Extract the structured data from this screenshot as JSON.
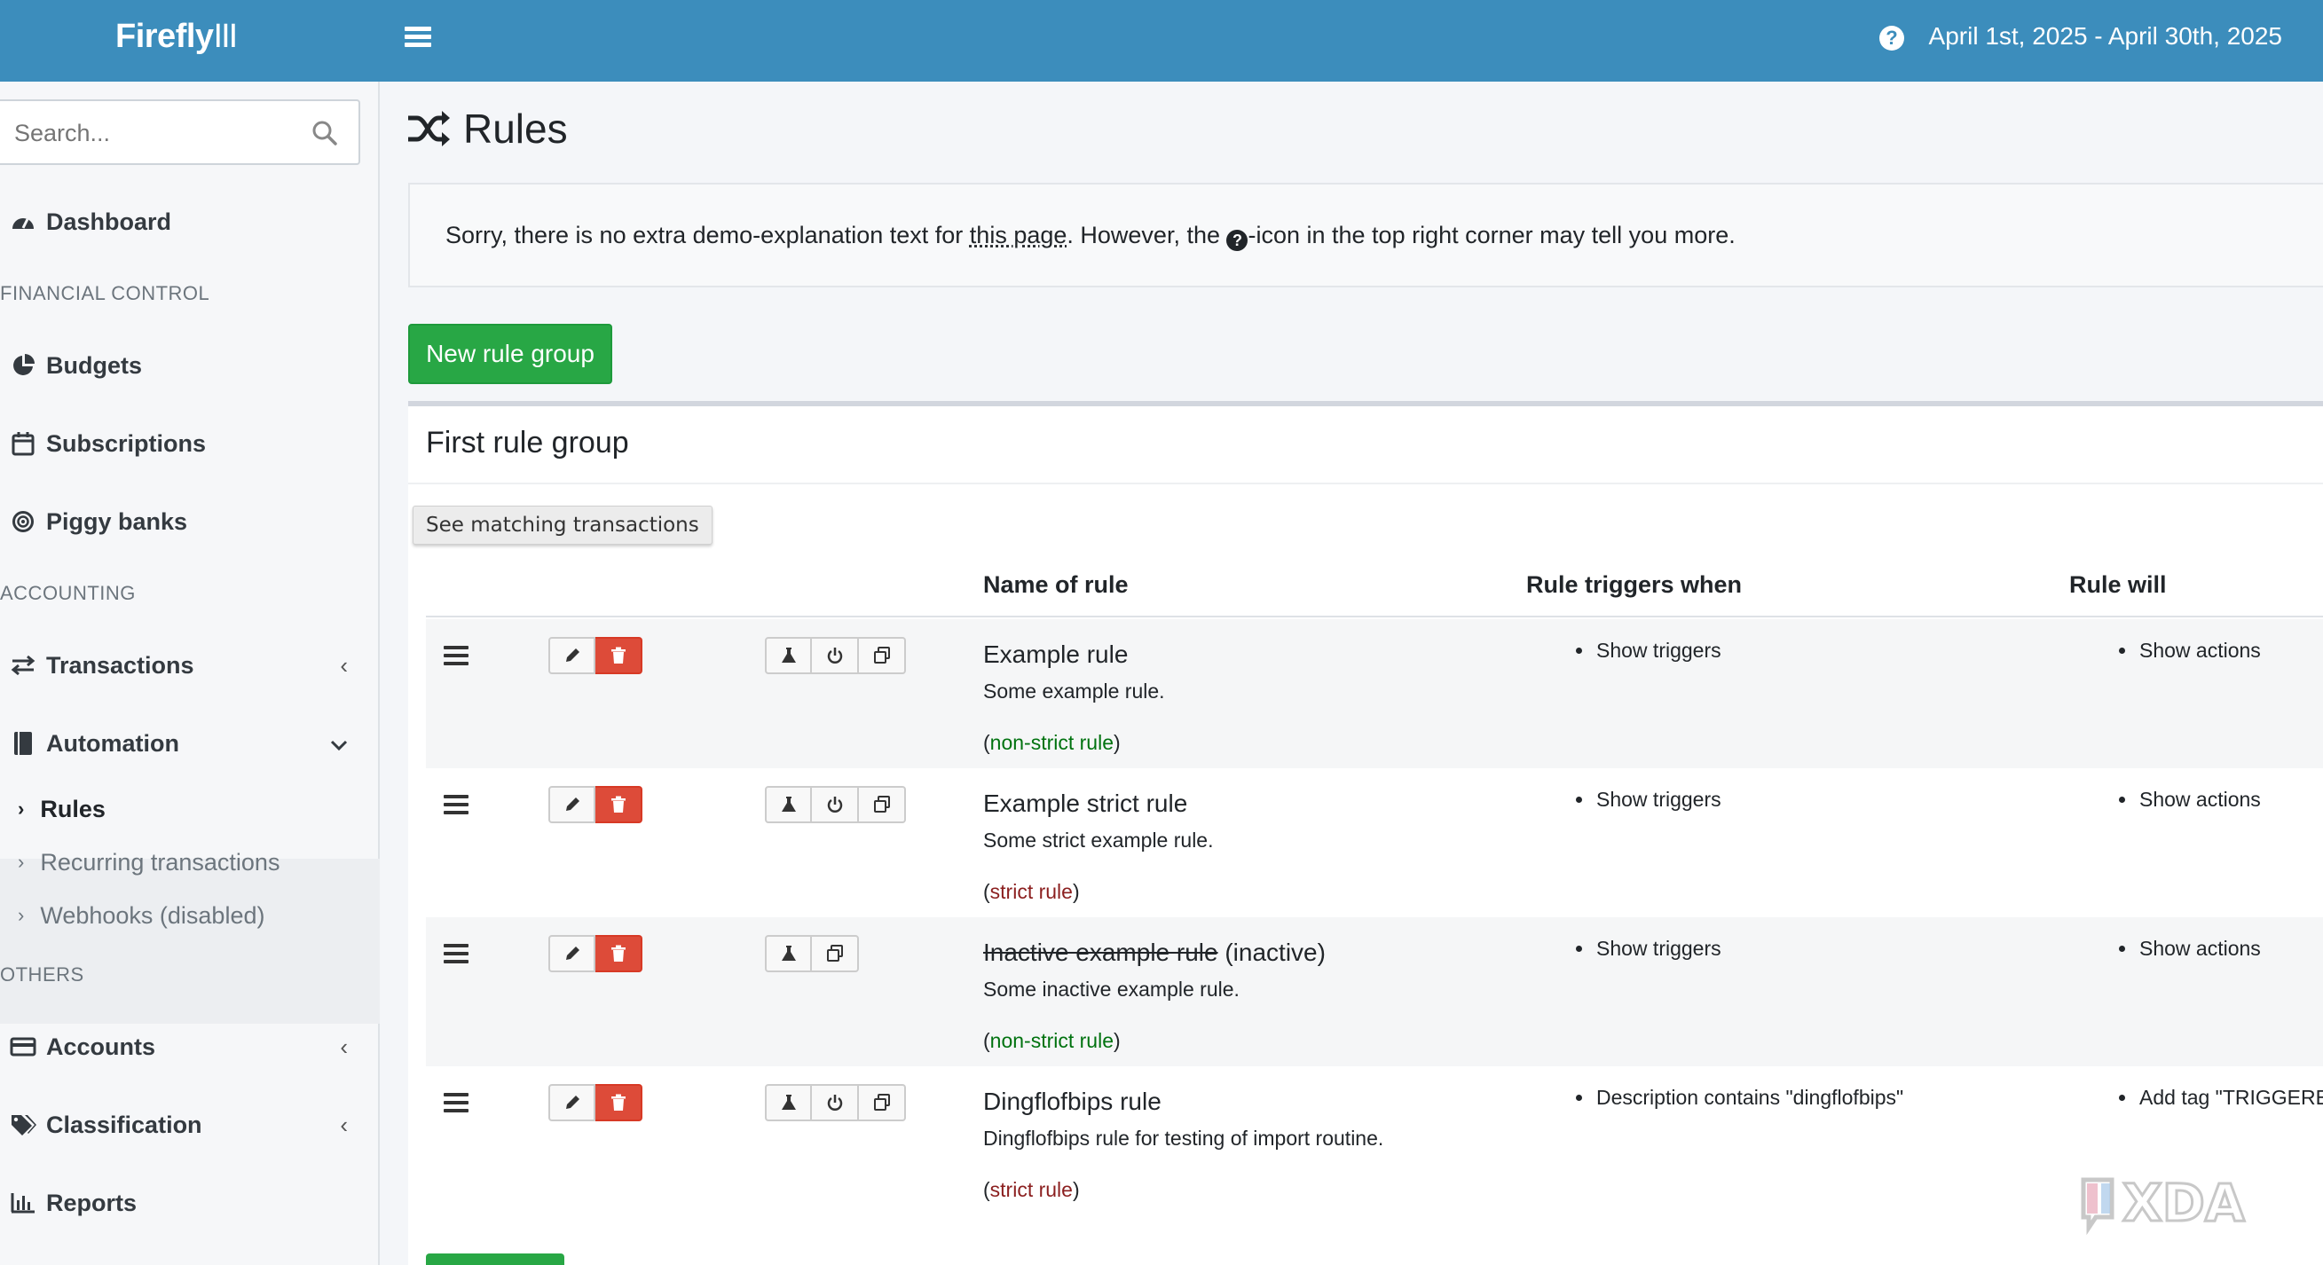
{
  "app": {
    "brand": "Firefly",
    "brand_bars": "III",
    "date_range": "April 1st, 2025 - April 30th, 2025"
  },
  "search": {
    "placeholder": "Search..."
  },
  "sidebar": {
    "dashboard": "Dashboard",
    "section_financial": "FINANCIAL CONTROL",
    "budgets": "Budgets",
    "subscriptions": "Subscriptions",
    "piggy_banks": "Piggy banks",
    "section_accounting": "ACCOUNTING",
    "transactions": "Transactions",
    "automation": "Automation",
    "automation_items": [
      {
        "label": "Rules",
        "active": true
      },
      {
        "label": "Recurring transactions",
        "active": false
      },
      {
        "label": "Webhooks (disabled)",
        "active": false
      }
    ],
    "section_others": "OTHERS",
    "accounts": "Accounts",
    "classification": "Classification",
    "reports": "Reports"
  },
  "page": {
    "title": "Rules",
    "callout_before": "Sorry, there is no extra demo-explanation text for ",
    "callout_link": "this page",
    "callout_mid": ". However, the ",
    "callout_icon": "?",
    "callout_after": "-icon in the top right corner may tell you more.",
    "new_rule_group": "New rule group"
  },
  "rule_group": {
    "title": "First rule group",
    "see_matching": "See matching transactions",
    "columns": [
      "Name of rule",
      "Rule triggers when",
      "Rule will"
    ],
    "rules": [
      {
        "name": "Example rule",
        "suffix": "",
        "description": "Some example rule.",
        "strict_open": "(",
        "strict": "non-strict rule",
        "strict_close": ")",
        "trigger": "Show triggers",
        "action": "Show actions"
      },
      {
        "name": "Example strict rule",
        "suffix": "",
        "description": "Some strict example rule.",
        "strict_open": "(",
        "strict": "strict rule",
        "strict_close": ")",
        "trigger": "Show triggers",
        "action": "Show actions"
      },
      {
        "name": "Inactive example rule",
        "suffix": " (inactive)",
        "description": "Some inactive example rule.",
        "strict_open": "(",
        "strict": "non-strict rule",
        "strict_close": ")",
        "trigger": "Show triggers",
        "action": "Show actions"
      },
      {
        "name": "Dingflofbips rule",
        "suffix": "",
        "description": "Dingflofbips rule for testing of import routine.",
        "strict_open": "(",
        "strict": "strict rule",
        "strict_close": ")",
        "trigger": "Description contains \"dingflofbips\"",
        "action": "Add tag \"TRIGGERED"
      }
    ]
  },
  "watermark": "XDA",
  "colors": {
    "topbar": "#3c8dbc",
    "success": "#28a745",
    "danger": "#dd4b39"
  }
}
